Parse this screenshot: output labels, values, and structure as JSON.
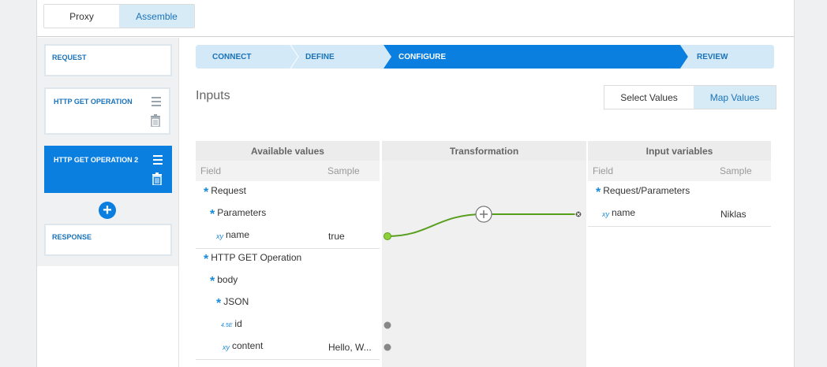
{
  "modes": {
    "proxy": "Proxy",
    "assemble": "Assemble"
  },
  "operations": {
    "request": "REQUEST",
    "op1": "HTTP GET OPERATION",
    "op2": "HTTP GET OPERATION 2",
    "response": "RESPONSE"
  },
  "wizard": {
    "connect": "CONNECT",
    "define": "DEFINE",
    "configure": "CONFIGURE",
    "review": "REVIEW"
  },
  "inputs": {
    "title": "Inputs",
    "select_values": "Select Values",
    "map_values": "Map Values"
  },
  "available": {
    "header": "Available values",
    "field_col": "Field",
    "sample_col": "Sample",
    "rows": [
      {
        "label": "Request",
        "icon": "asterisk-icon"
      },
      {
        "label": "Parameters",
        "icon": "asterisk-icon"
      },
      {
        "label": "name",
        "icon": "xy",
        "sample": "true"
      },
      {
        "label": "HTTP GET Operation",
        "icon": "asterisk-icon"
      },
      {
        "label": "body",
        "icon": "asterisk-icon"
      },
      {
        "label": "JSON",
        "icon": "asterisk-icon"
      },
      {
        "label": "id",
        "icon": "4.5E"
      },
      {
        "label": "content",
        "icon": "xy",
        "sample": "Hello, W..."
      }
    ]
  },
  "transformation": {
    "header": "Transformation"
  },
  "input_vars": {
    "header": "Input variables",
    "field_col": "Field",
    "sample_col": "Sample",
    "rows": [
      {
        "label": "Request/Parameters",
        "icon": "asterisk-icon"
      },
      {
        "label": "name",
        "icon": "xy",
        "sample": "Niklas"
      }
    ]
  },
  "colors": {
    "accent": "#0a7fe0",
    "light_accent": "#d7ebf7",
    "connector": "#5a9e1e"
  }
}
